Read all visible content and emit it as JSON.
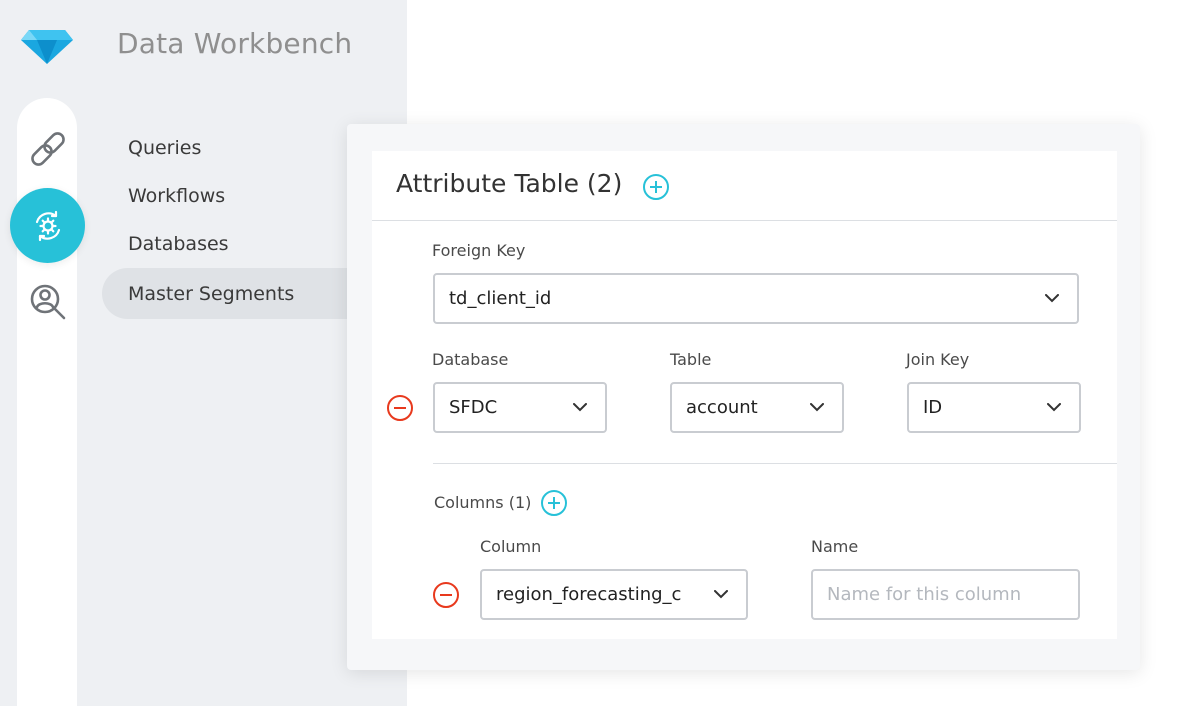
{
  "app": {
    "title": "Data Workbench"
  },
  "rail": {
    "icons": [
      "link-icon",
      "gear-sync-icon",
      "user-search-icon"
    ],
    "active_color": "#27c1d8"
  },
  "sidebar": {
    "items": [
      {
        "label": "Queries",
        "active": false
      },
      {
        "label": "Workflows",
        "active": false
      },
      {
        "label": "Databases",
        "active": false
      },
      {
        "label": "Master Segments",
        "active": true
      }
    ]
  },
  "attribute_table": {
    "title": "Attribute Table (2)",
    "foreign_key": {
      "label": "Foreign Key",
      "value": "td_client_id"
    },
    "database": {
      "label": "Database",
      "value": "SFDC"
    },
    "table": {
      "label": "Table",
      "value": "account"
    },
    "join_key": {
      "label": "Join Key",
      "value": "ID"
    },
    "columns": {
      "label": "Columns (1)",
      "column_header": "Column",
      "name_header": "Name",
      "rows": [
        {
          "column": "region_forecasting_c",
          "name_value": "",
          "name_placeholder": "Name for this column"
        }
      ]
    }
  },
  "colors": {
    "accent": "#27c1d8",
    "remove": "#e8391d",
    "sidebar_bg": "#eef0f3"
  }
}
